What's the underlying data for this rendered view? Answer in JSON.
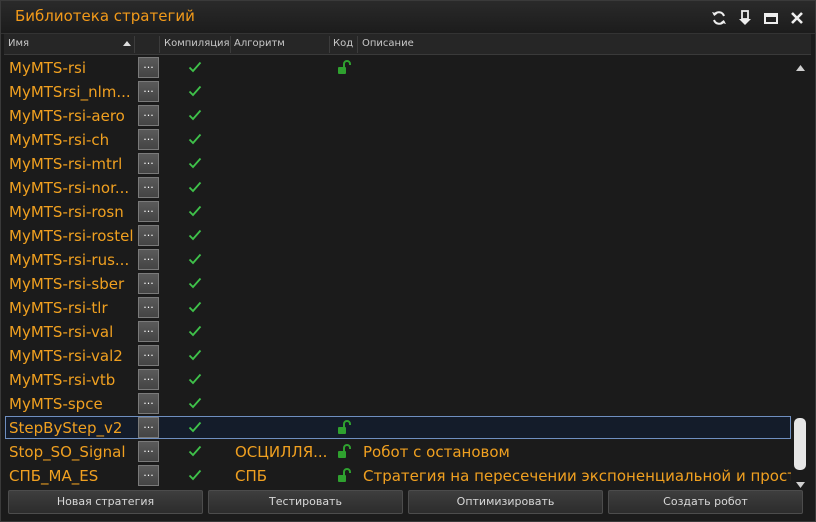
{
  "window": {
    "title": "Библиотека стратегий",
    "icons": [
      "refresh-icon",
      "pin-down-icon",
      "minimize-icon",
      "close-icon"
    ]
  },
  "header": {
    "col_name": "Имя",
    "col_compile": "Компиляция",
    "col_algo": "Алгоритм",
    "col_code": "Код",
    "col_desc": "Описание",
    "sort": "ascending"
  },
  "colors": {
    "name_text": "#f0a020",
    "title_text": "#f29a1a",
    "check": "#3fc24a",
    "lock": "#2fa12f",
    "selection_border": "#6f8fc0"
  },
  "rows": [
    {
      "name": "MyMTS-rsi",
      "dots": "...",
      "compiled": true,
      "algo": "",
      "code_icon": true,
      "desc": ""
    },
    {
      "name": "MyMTSrsi_nlm...",
      "dots": "...",
      "compiled": true,
      "algo": "",
      "code_icon": false,
      "desc": ""
    },
    {
      "name": "MyMTS-rsi-aero",
      "dots": "...",
      "compiled": true,
      "algo": "",
      "code_icon": false,
      "desc": ""
    },
    {
      "name": "MyMTS-rsi-ch",
      "dots": "...",
      "compiled": true,
      "algo": "",
      "code_icon": false,
      "desc": ""
    },
    {
      "name": "MyMTS-rsi-mtrl",
      "dots": "...",
      "compiled": true,
      "algo": "",
      "code_icon": false,
      "desc": ""
    },
    {
      "name": "MyMTS-rsi-nor...",
      "dots": "...",
      "compiled": true,
      "algo": "",
      "code_icon": false,
      "desc": ""
    },
    {
      "name": "MyMTS-rsi-rosn",
      "dots": "...",
      "compiled": true,
      "algo": "",
      "code_icon": false,
      "desc": ""
    },
    {
      "name": "MyMTS-rsi-rostel",
      "dots": "...",
      "compiled": true,
      "algo": "",
      "code_icon": false,
      "desc": ""
    },
    {
      "name": "MyMTS-rsi-rus...",
      "dots": "...",
      "compiled": true,
      "algo": "",
      "code_icon": false,
      "desc": ""
    },
    {
      "name": "MyMTS-rsi-sber",
      "dots": "...",
      "compiled": true,
      "algo": "",
      "code_icon": false,
      "desc": ""
    },
    {
      "name": "MyMTS-rsi-tlr",
      "dots": "...",
      "compiled": true,
      "algo": "",
      "code_icon": false,
      "desc": ""
    },
    {
      "name": "MyMTS-rsi-val",
      "dots": "...",
      "compiled": true,
      "algo": "",
      "code_icon": false,
      "desc": ""
    },
    {
      "name": "MyMTS-rsi-val2",
      "dots": "...",
      "compiled": true,
      "algo": "",
      "code_icon": false,
      "desc": ""
    },
    {
      "name": "MyMTS-rsi-vtb",
      "dots": "...",
      "compiled": true,
      "algo": "",
      "code_icon": false,
      "desc": ""
    },
    {
      "name": "MyMTS-spce",
      "dots": "...",
      "compiled": true,
      "algo": "",
      "code_icon": false,
      "desc": ""
    },
    {
      "name": "StepByStep_v2",
      "dots": "...",
      "compiled": true,
      "algo": "",
      "code_icon": true,
      "desc": "",
      "selected": true
    },
    {
      "name": "Stop_SO_Signal",
      "dots": "...",
      "compiled": true,
      "algo": "ОСЦИЛЛЯ...",
      "code_icon": true,
      "desc": "Робот с остановом"
    },
    {
      "name": "СПБ_MA_ES",
      "dots": "...",
      "compiled": true,
      "algo": "СПБ",
      "code_icon": true,
      "desc": "Стратегия на пересечении экспоненциальной и просто..."
    }
  ],
  "scrollbar": {
    "position": "bottom"
  },
  "footer": {
    "new_strategy": "Новая стратегия",
    "test": "Тестировать",
    "optimize": "Оптимизировать",
    "create_robot": "Создать робот"
  }
}
